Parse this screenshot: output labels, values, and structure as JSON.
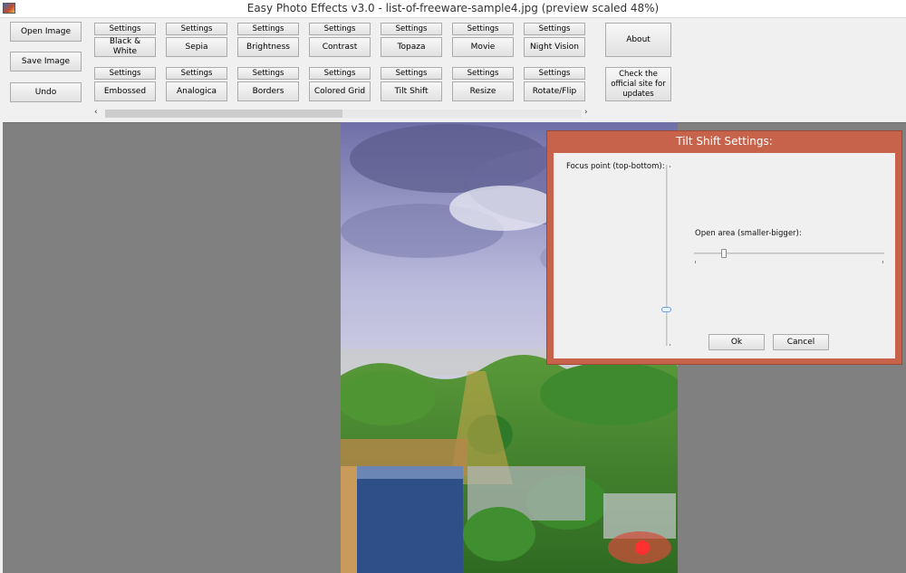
{
  "window": {
    "title": "Easy Photo Effects v3.0 - list-of-freeware-sample4.jpg (preview scaled 48%)"
  },
  "toolbar": {
    "open_image": "Open Image",
    "save_image": "Save Image",
    "undo": "Undo",
    "about": "About",
    "check_updates": "Check the official site for updates",
    "settings_label": "Settings",
    "effects_row1": [
      "Black & White",
      "Sepia",
      "Brightness",
      "Contrast",
      "Topaza",
      "Movie",
      "Night Vision"
    ],
    "effects_row2": [
      "Embossed",
      "Analogica",
      "Borders",
      "Colored Grid",
      "Tilt Shift",
      "Resize",
      "Rotate/Flip"
    ]
  },
  "scrollbar": {
    "left_arrow": "‹",
    "right_arrow": "›"
  },
  "dialog": {
    "title": "Tilt Shift Settings:",
    "focus_label": "Focus point (top-bottom):",
    "open_area_label": "Open area (smaller-bigger):",
    "ok": "Ok",
    "cancel": "Cancel",
    "colors": {
      "frame": "#c8634b"
    }
  }
}
